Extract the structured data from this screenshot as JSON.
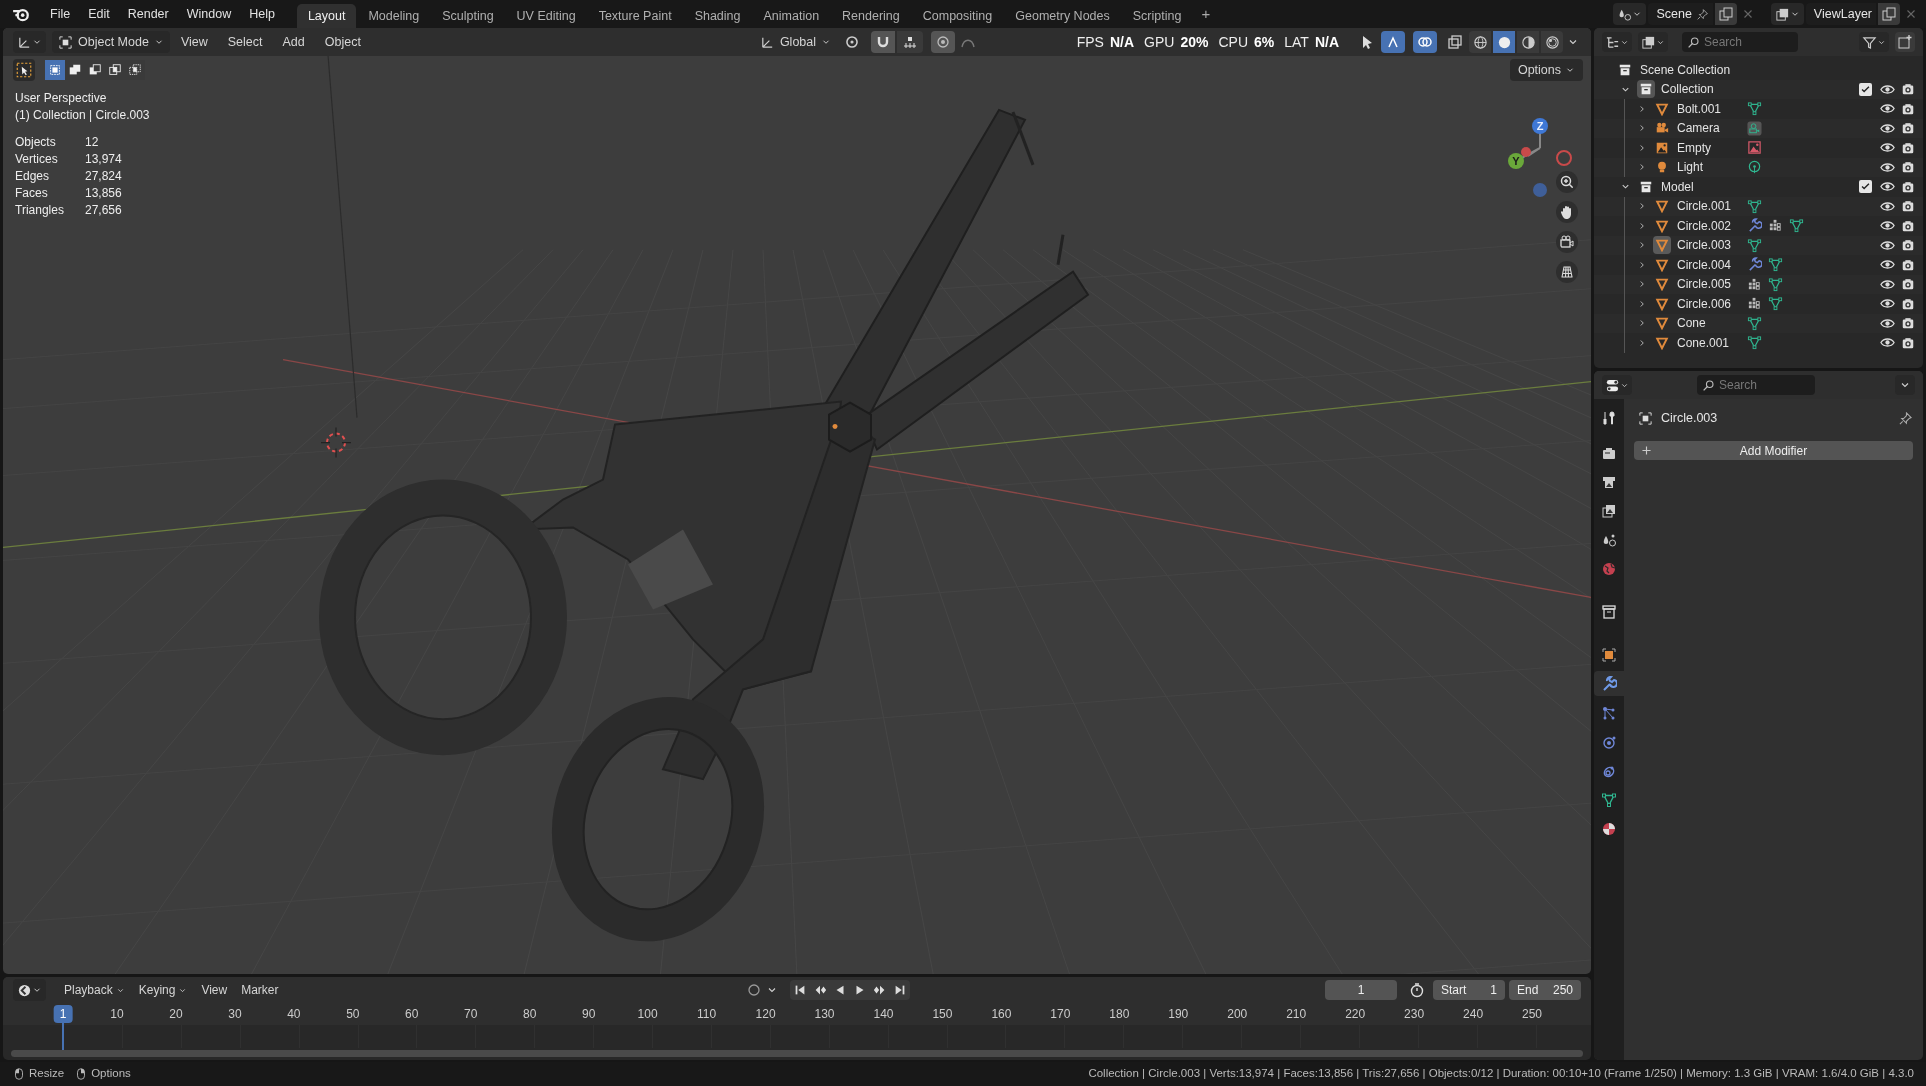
{
  "topbar": {
    "menus": [
      "File",
      "Edit",
      "Render",
      "Window",
      "Help"
    ],
    "workspaces": [
      {
        "label": "Layout",
        "selected": true
      },
      {
        "label": "Modeling",
        "selected": false
      },
      {
        "label": "Sculpting",
        "selected": false
      },
      {
        "label": "UV Editing",
        "selected": false
      },
      {
        "label": "Texture Paint",
        "selected": false
      },
      {
        "label": "Shading",
        "selected": false
      },
      {
        "label": "Animation",
        "selected": false
      },
      {
        "label": "Rendering",
        "selected": false
      },
      {
        "label": "Compositing",
        "selected": false
      },
      {
        "label": "Geometry Nodes",
        "selected": false
      },
      {
        "label": "Scripting",
        "selected": false
      }
    ],
    "add_workspace": "+",
    "scene": "Scene",
    "view_layer": "ViewLayer"
  },
  "viewport": {
    "mode": "Object Mode",
    "menus": [
      "View",
      "Select",
      "Add",
      "Object"
    ],
    "orientation": "Global",
    "perf": [
      {
        "label": "FPS",
        "value": "N/A"
      },
      {
        "label": "GPU",
        "value": "20%"
      },
      {
        "label": "CPU",
        "value": "6%"
      },
      {
        "label": "LAT",
        "value": "N/A"
      }
    ],
    "shading": [
      {
        "kind": "wireframe",
        "selected": false
      },
      {
        "kind": "solid",
        "selected": true
      },
      {
        "kind": "material",
        "selected": false
      },
      {
        "kind": "rendered",
        "selected": false
      }
    ],
    "select_modes": [
      {
        "kind": "new",
        "selected": true
      },
      {
        "kind": "extend",
        "selected": false
      },
      {
        "kind": "subtract",
        "selected": false
      },
      {
        "kind": "invert",
        "selected": false
      },
      {
        "kind": "intersect",
        "selected": false
      }
    ],
    "options": "Options",
    "view_name": "User Perspective",
    "context": "(1) Collection | Circle.003",
    "stats": [
      {
        "label": "Objects",
        "value": "12"
      },
      {
        "label": "Vertices",
        "value": "13,974"
      },
      {
        "label": "Edges",
        "value": "27,824"
      },
      {
        "label": "Faces",
        "value": "13,856"
      },
      {
        "label": "Triangles",
        "value": "27,656"
      }
    ],
    "gizmo_axes": [
      {
        "label": "Z",
        "kind": "z"
      },
      {
        "label": "Y",
        "kind": "y"
      }
    ]
  },
  "outliner": {
    "search": {
      "placeholder": "Search"
    },
    "root": "Scene Collection",
    "collections": [
      {
        "label": "Collection",
        "expanded": true,
        "checked": true,
        "active": true,
        "children": [
          {
            "label": "Bolt.001",
            "kind": "mesh",
            "active": false,
            "extras": [
              {
                "kind": "mesh_data"
              }
            ]
          },
          {
            "label": "Camera",
            "kind": "camera",
            "active": false,
            "extras": [
              {
                "kind": "camera_data"
              }
            ]
          },
          {
            "label": "Empty",
            "kind": "empty",
            "active": false,
            "extras": [
              {
                "kind": "image_data"
              }
            ]
          },
          {
            "label": "Light",
            "kind": "light",
            "active": false,
            "extras": [
              {
                "kind": "light_data"
              }
            ]
          }
        ]
      },
      {
        "label": "Model",
        "expanded": true,
        "checked": true,
        "active": false,
        "children": [
          {
            "label": "Circle.001",
            "kind": "mesh",
            "active": false,
            "extras": [
              {
                "kind": "mesh_data"
              }
            ]
          },
          {
            "label": "Circle.002",
            "kind": "mesh",
            "active": false,
            "extras": [
              {
                "kind": "modifier"
              },
              {
                "kind": "instances"
              },
              {
                "kind": "mesh_data"
              }
            ]
          },
          {
            "label": "Circle.003",
            "kind": "mesh",
            "active": true,
            "extras": [
              {
                "kind": "mesh_data"
              }
            ]
          },
          {
            "label": "Circle.004",
            "kind": "mesh",
            "active": false,
            "extras": [
              {
                "kind": "modifier"
              },
              {
                "kind": "mesh_data"
              }
            ]
          },
          {
            "label": "Circle.005",
            "kind": "mesh",
            "active": false,
            "extras": [
              {
                "kind": "instances"
              },
              {
                "kind": "mesh_data"
              }
            ]
          },
          {
            "label": "Circle.006",
            "kind": "mesh",
            "active": false,
            "extras": [
              {
                "kind": "instances"
              },
              {
                "kind": "mesh_data"
              }
            ]
          },
          {
            "label": "Cone",
            "kind": "mesh",
            "active": false,
            "extras": [
              {
                "kind": "mesh_data"
              }
            ]
          },
          {
            "label": "Cone.001",
            "kind": "mesh",
            "active": false,
            "extras": [
              {
                "kind": "mesh_data"
              }
            ]
          }
        ]
      }
    ]
  },
  "properties": {
    "search": {
      "placeholder": "Search"
    },
    "tabs": [
      {
        "kind": "tool",
        "selected": false
      },
      {
        "kind": "render",
        "selected": false
      },
      {
        "kind": "output",
        "selected": false
      },
      {
        "kind": "view_layer",
        "selected": false
      },
      {
        "kind": "scene",
        "selected": false
      },
      {
        "kind": "world",
        "selected": false
      },
      {
        "kind": "collection",
        "selected": false
      },
      {
        "kind": "object",
        "selected": false
      },
      {
        "kind": "modifier",
        "selected": true
      },
      {
        "kind": "particles",
        "selected": false
      },
      {
        "kind": "physics",
        "selected": false
      },
      {
        "kind": "constraints",
        "selected": false
      },
      {
        "kind": "data",
        "selected": false
      },
      {
        "kind": "material",
        "selected": false
      }
    ],
    "object_name": "Circle.003",
    "add_modifier": "Add Modifier"
  },
  "timeline": {
    "menus": [
      "Playback",
      "Keying",
      "View",
      "Marker"
    ],
    "current_frame": "1",
    "start_label": "Start",
    "start": "1",
    "end_label": "End",
    "end": "250",
    "ruler": [
      {
        "label": "1",
        "selected": true
      },
      {
        "label": "10",
        "selected": false
      },
      {
        "label": "20",
        "selected": false
      },
      {
        "label": "30",
        "selected": false
      },
      {
        "label": "40",
        "selected": false
      },
      {
        "label": "50",
        "selected": false
      },
      {
        "label": "60",
        "selected": false
      },
      {
        "label": "70",
        "selected": false
      },
      {
        "label": "80",
        "selected": false
      },
      {
        "label": "90",
        "selected": false
      },
      {
        "label": "100",
        "selected": false
      },
      {
        "label": "110",
        "selected": false
      },
      {
        "label": "120",
        "selected": false
      },
      {
        "label": "130",
        "selected": false
      },
      {
        "label": "140",
        "selected": false
      },
      {
        "label": "150",
        "selected": false
      },
      {
        "label": "160",
        "selected": false
      },
      {
        "label": "170",
        "selected": false
      },
      {
        "label": "180",
        "selected": false
      },
      {
        "label": "190",
        "selected": false
      },
      {
        "label": "200",
        "selected": false
      },
      {
        "label": "210",
        "selected": false
      },
      {
        "label": "220",
        "selected": false
      },
      {
        "label": "230",
        "selected": false
      },
      {
        "label": "240",
        "selected": false
      },
      {
        "label": "250",
        "selected": false
      }
    ]
  },
  "status_bar": {
    "hints": [
      {
        "kind": "left_mouse",
        "label": "Resize"
      },
      {
        "kind": "right_mouse",
        "label": "Options"
      }
    ],
    "info": "Collection | Circle.003 | Verts:13,974 | Faces:13,856 | Tris:27,656 | Objects:0/12 | Duration: 00:10+10 (Frame 1/250) | Memory: 1.3 GiB | VRAM: 1.6/4.0 GiB | 4.3.0"
  }
}
